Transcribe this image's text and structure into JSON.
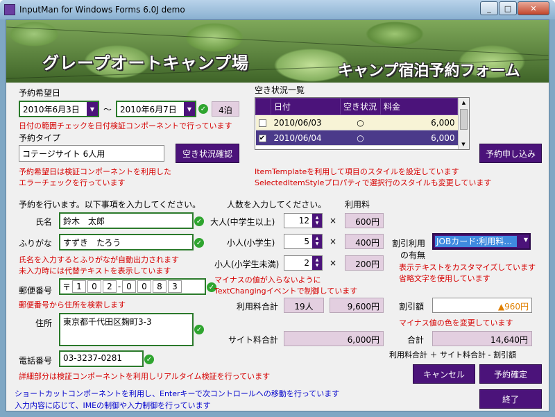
{
  "window": {
    "title": "InputMan for Windows Forms 6.0J demo",
    "min": "_",
    "max": "□",
    "close": "✕"
  },
  "banner": {
    "title": "グレープオートキャンプ場",
    "subtitle": "キャンプ宿泊予約フォーム"
  },
  "reservation": {
    "date_label": "予約希望日",
    "start_date": "2010年6月3日",
    "tilde": "～",
    "end_date": "2010年6月7日",
    "nights": "4泊",
    "date_note": "日付の範囲チェックを日付検証コンポーネントで行っています",
    "type_label": "予約タイプ",
    "type_value": "コテージサイト 6人用",
    "check_button": "空き状況確認",
    "type_note1": "予約希望日は検証コンポーネントを利用した",
    "type_note2": "エラーチェックを行っています"
  },
  "availability": {
    "label": "空き状況一覧",
    "headers": [
      "日付",
      "空き状況",
      "料金"
    ],
    "rows": [
      {
        "checked": "",
        "date": "2010/06/03",
        "status": "○",
        "price": "6,000"
      },
      {
        "checked": "✔",
        "date": "2010/06/04",
        "status": "○",
        "price": "6,000"
      }
    ],
    "apply_button": "予約申し込み",
    "note1": "ItemTemplateを利用して項目のスタイルを設定しています",
    "note2": "SelectedItemStyleプロパティで選択行のスタイルも変更しています"
  },
  "personal": {
    "intro": "予約を行います。以下事項を入力してください。",
    "name_label": "氏名",
    "name_value": "鈴木　太郎",
    "kana_label": "ふりがな",
    "kana_value": "すずき　たろう",
    "kana_note1": "氏名を入力するとふりがなが自動出力されます",
    "kana_note2": "未入力時には代替テキストを表示しています",
    "zip_label": "郵便番号",
    "zip_mark": "〒",
    "zip_digits": [
      "1",
      "0",
      "2",
      "0",
      "0",
      "8",
      "3"
    ],
    "zip_dash": "-",
    "zip_note": "郵便番号から住所を検索します",
    "address_label": "住所",
    "address_value": "東京都千代田区麹町3-3",
    "phone_label": "電話番号",
    "phone_value": "03-3237-0281",
    "phone_note": "詳細部分は検証コンポーネントを利用しリアルタイム検証を行っています"
  },
  "people": {
    "intro": "人数を入力してください。",
    "fee_label": "利用料",
    "times": "×",
    "adult_label": "大人(中学生以上)",
    "adult_count": "12",
    "adult_fee": "600円",
    "child_label": "小人(小学生)",
    "child_count": "5",
    "child_fee": "400円",
    "infant_label": "小人(小学生未満)",
    "infant_count": "2",
    "infant_fee": "200円",
    "note1": "マイナスの値が入らないように",
    "note2": "TextChangingイベントで制御しています",
    "total_label": "利用料合計",
    "total_people": "19人",
    "total_fee": "9,600円",
    "site_label": "サイト料合計",
    "site_fee": "6,000円"
  },
  "discount": {
    "label": "割引利用",
    "label2": "の有無",
    "value": "JOBカード:利用料…",
    "note1": "表示テキストをカスタマイズしています",
    "note2": "省略文字を使用しています",
    "amount_label": "割引額",
    "amount_value": "▲960円",
    "amount_note": "マイナス値の色を変更しています",
    "sum_label": "合計",
    "sum_value": "14,640円",
    "formula": "利用料合計 ＋ サイト料合計 - 割引額"
  },
  "footer": {
    "note1": "ショートカットコンポーネントを利用し、Enterキーで次コントロールへの移動を行っています",
    "note2": "入力内容に応じて、IMEの制御や入力制御を行っています",
    "cancel_button": "キャンセル",
    "confirm_button": "予約確定",
    "exit_button": "終了"
  },
  "colors": {
    "accent": "#4b137a",
    "note": "#d60000",
    "info": "#0000cc",
    "readonly": "#e3cfe0",
    "valid": "#2fa52f"
  }
}
